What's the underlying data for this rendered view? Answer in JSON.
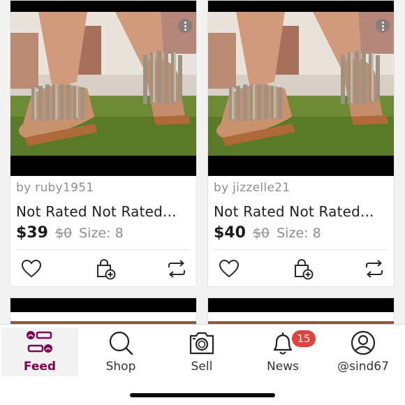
{
  "listings": [
    {
      "seller": "by ruby1951",
      "title": "Not Rated Not Rated...",
      "price": "$39",
      "original_price": "$0",
      "size": "Size: 8"
    },
    {
      "seller": "by jizzelle21",
      "title": "Not Rated Not Rated...",
      "price": "$40",
      "original_price": "$0",
      "size": "Size: 8"
    }
  ],
  "tabbar": {
    "feed": "Feed",
    "shop": "Shop",
    "sell": "Sell",
    "news": "News",
    "news_badge": "15",
    "profile": "@sind67"
  },
  "colors": {
    "accent": "#7f0353",
    "badge": "#e4413d"
  },
  "icons": [
    "heart-icon",
    "bundle-bag-icon",
    "share-icon",
    "feed-icon",
    "search-icon",
    "camera-icon",
    "bell-icon",
    "user-icon",
    "more-icon"
  ]
}
